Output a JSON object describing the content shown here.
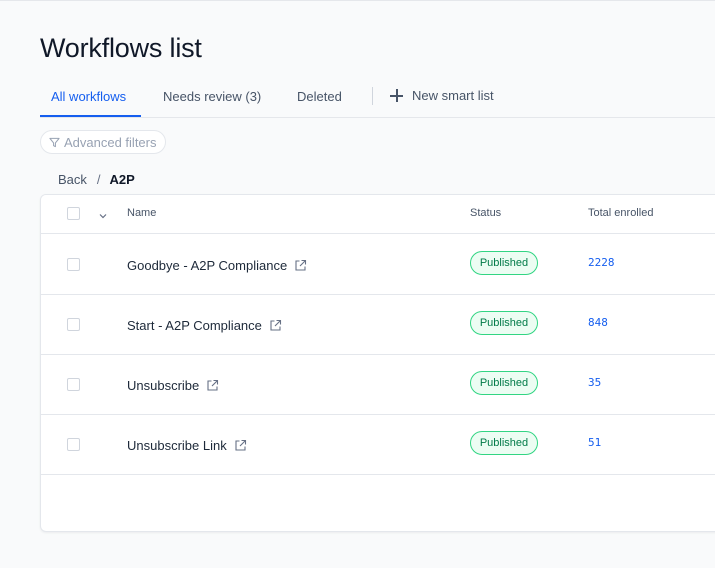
{
  "page": {
    "title": "Workflows list"
  },
  "tabs": [
    {
      "label": "All workflows"
    },
    {
      "label": "Needs review (3)"
    },
    {
      "label": "Deleted"
    }
  ],
  "new_smart_list": {
    "label": "New smart list",
    "icon": "plus-icon"
  },
  "filters": {
    "label": "Advanced filters",
    "icon": "funnel-icon"
  },
  "breadcrumb": {
    "back": "Back",
    "separator": "/",
    "current": "A2P"
  },
  "table": {
    "columns": {
      "name": "Name",
      "status": "Status",
      "enrolled": "Total enrolled"
    },
    "rows": [
      {
        "name": "Goodbye - A2P Compliance",
        "status": "Published",
        "enrolled": "2228"
      },
      {
        "name": "Start - A2P Compliance",
        "status": "Published",
        "enrolled": "848"
      },
      {
        "name": "Unsubscribe",
        "status": "Published",
        "enrolled": "35"
      },
      {
        "name": "Unsubscribe Link",
        "status": "Published",
        "enrolled": "51"
      }
    ]
  },
  "colors": {
    "accent": "#155eef",
    "published_border": "#32d583",
    "published_text": "#027a48"
  }
}
